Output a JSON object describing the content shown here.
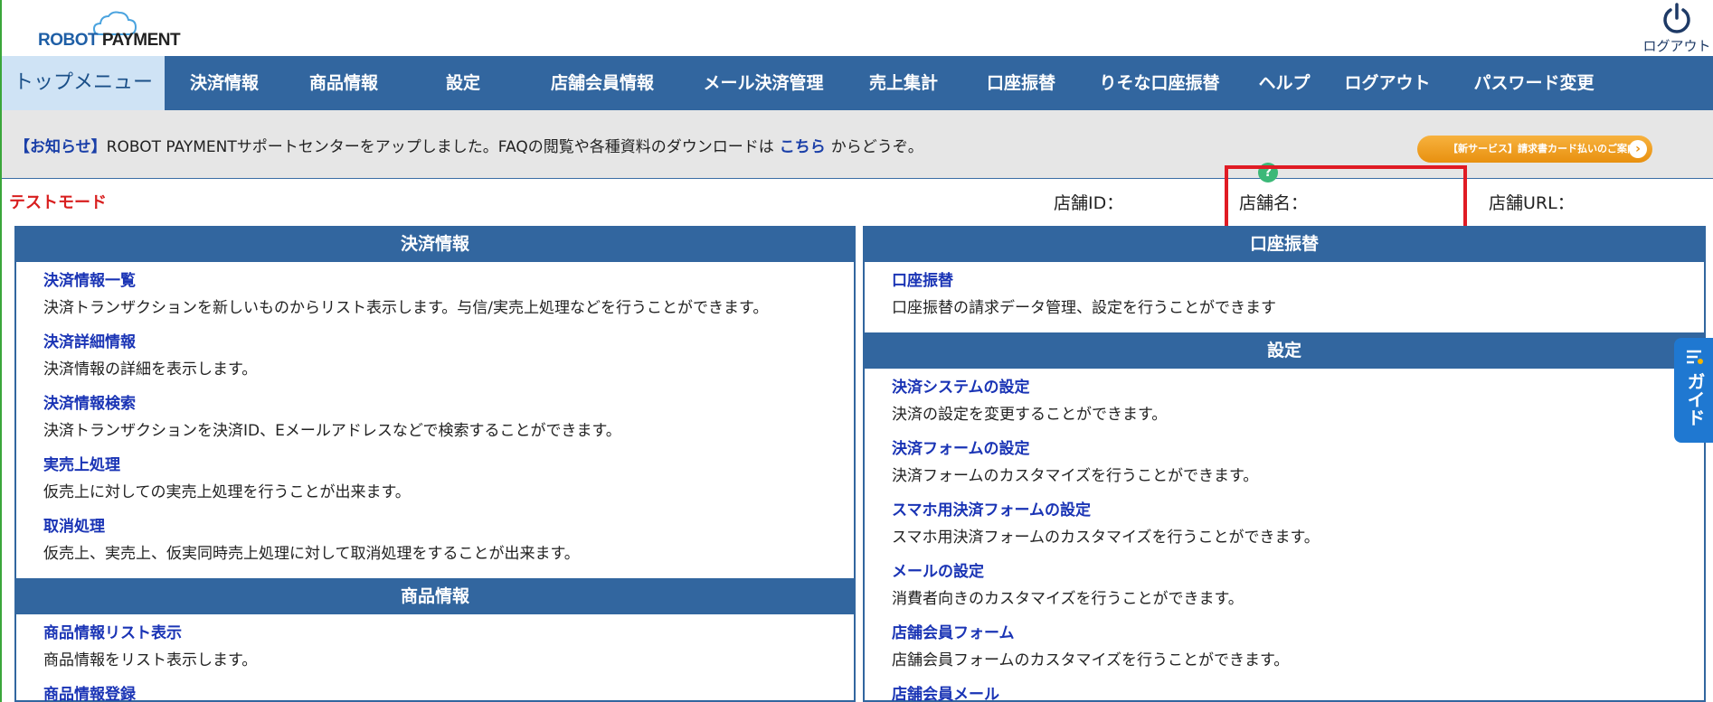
{
  "header": {
    "logo_robot": "ROBOT",
    "logo_payment": "PAYMENT",
    "logout_label": "ログアウト"
  },
  "nav": {
    "items": [
      {
        "label": "トップメニュー",
        "active": true
      },
      {
        "label": "決済情報"
      },
      {
        "label": "商品情報"
      },
      {
        "label": "設定"
      },
      {
        "label": "店舗会員情報"
      },
      {
        "label": "メール決済管理"
      },
      {
        "label": "売上集計"
      },
      {
        "label": "口座振替"
      },
      {
        "label": "りそな口座振替"
      },
      {
        "label": "ヘルプ"
      },
      {
        "label": "ログアウト"
      },
      {
        "label": "パスワード変更"
      }
    ]
  },
  "notice": {
    "tag": "【お知らせ】",
    "text_before": "ROBOT PAYMENTサポートセンターをアップしました。FAQの閲覧や各種資料のダウンロードは",
    "link": "こちら",
    "text_after": "からどうぞ。",
    "promo_label": "【新サービス】請求書カード払いのご案内",
    "promo_arrow": "›"
  },
  "info": {
    "testmode": "テストモード",
    "shop_id_label": "店舗ID：",
    "shop_name_label": "店舗名：",
    "shop_url_label": "店舗URL：",
    "help_mark": "?"
  },
  "left": {
    "sections": [
      {
        "title": "決済情報",
        "entries": [
          {
            "title": "決済情報一覧",
            "desc": "決済トランザクションを新しいものからリスト表示します。与信/実売上処理などを行うことができます。"
          },
          {
            "title": "決済詳細情報",
            "desc": "決済情報の詳細を表示します。"
          },
          {
            "title": "決済情報検索",
            "desc": "決済トランザクションを決済ID、Eメールアドレスなどで検索することができます。"
          },
          {
            "title": "実売上処理",
            "desc": "仮売上に対しての実売上処理を行うことが出来ます。"
          },
          {
            "title": "取消処理",
            "desc": "仮売上、実売上、仮実同時売上処理に対して取消処理をすることが出来ます。"
          }
        ]
      },
      {
        "title": "商品情報",
        "entries": [
          {
            "title": "商品情報リスト表示",
            "desc": "商品情報をリスト表示します。"
          },
          {
            "title": "商品情報登録",
            "desc": ""
          }
        ]
      }
    ]
  },
  "right": {
    "sections": [
      {
        "title": "口座振替",
        "entries": [
          {
            "title": "口座振替",
            "desc": "口座振替の請求データ管理、設定を行うことができます"
          }
        ]
      },
      {
        "title": "設定",
        "entries": [
          {
            "title": "決済システムの設定",
            "desc": "決済の設定を変更することができます。"
          },
          {
            "title": "決済フォームの設定",
            "desc": "決済フォームのカスタマイズを行うことができます。"
          },
          {
            "title": "スマホ用決済フォームの設定",
            "desc": "スマホ用決済フォームのカスタマイズを行うことができます。"
          },
          {
            "title": "メールの設定",
            "desc": "消費者向きのカスタマイズを行うことができます。"
          },
          {
            "title": "店舗会員フォーム",
            "desc": "店舗会員フォームのカスタマイズを行うことができます。"
          },
          {
            "title": "店舗会員メール",
            "desc": ""
          }
        ]
      }
    ]
  },
  "guide": {
    "label": "ガイド"
  },
  "colors": {
    "nav_bg": "#32669f",
    "nav_active_bg": "#cfe3f5",
    "link": "#1a34b5",
    "alert_red": "#d81e1e",
    "highlight_red": "#e01b24",
    "guide_blue": "#1f78d1"
  }
}
